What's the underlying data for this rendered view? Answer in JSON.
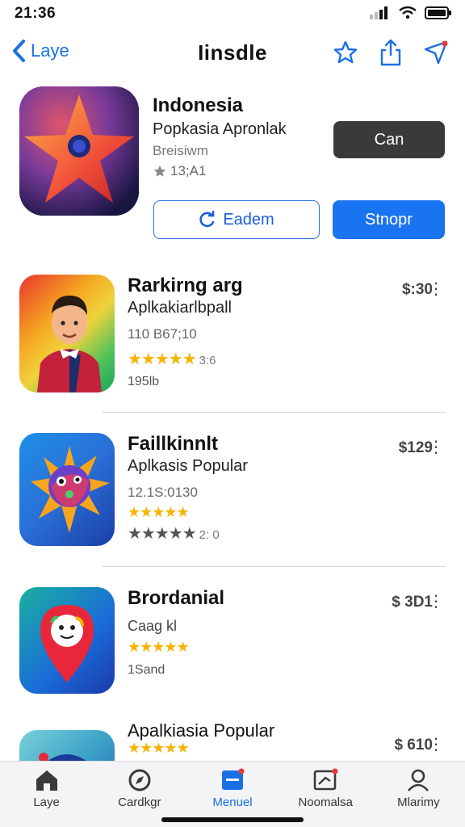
{
  "status": {
    "time": "21:36"
  },
  "nav": {
    "back_label": "Laye",
    "title": "Iinsdle"
  },
  "featured": {
    "title": "Indonesia",
    "subtitle": "Popkasia Apronlak",
    "developer": "Breisiwm",
    "rating": "13;A1",
    "primary_dark_button": "Can",
    "outline_button": "Eadem",
    "primary_button": "Stnopr"
  },
  "apps": [
    {
      "name": "Rarkirng arg",
      "subtitle": "Aplkakiarlbpall",
      "meta": "110 B67;10",
      "stars": "★★★★★",
      "star_count": "3:6",
      "extra": "195lb",
      "price": "$:30"
    },
    {
      "name": "Faillkinnlt",
      "subtitle": "Aplkasis Popular",
      "meta": "12.1S:0130",
      "stars": "★★★★★",
      "star_count": "",
      "stars2": "★★★★★",
      "star_count2": "2: 0",
      "price": "$129"
    },
    {
      "name": "Brordanial",
      "subtitle": "Caag kl",
      "stars": "★★★★★",
      "extra": "1Sand",
      "price": "$ 3D1"
    },
    {
      "name": "Apalkiasia Popular",
      "stars": "★★★★★",
      "price": "$ 610"
    }
  ],
  "tabs": [
    {
      "label": "Laye",
      "icon": "home-icon"
    },
    {
      "label": "Cardkgr",
      "icon": "compass-icon"
    },
    {
      "label": "Menuel",
      "icon": "apps-icon",
      "active": true
    },
    {
      "label": "Noomalsa",
      "icon": "news-icon"
    },
    {
      "label": "Mlarimy",
      "icon": "person-icon"
    }
  ],
  "colors": {
    "accent": "#1a73f0",
    "star": "#f5b400",
    "dark_button": "#3a3a3c"
  }
}
